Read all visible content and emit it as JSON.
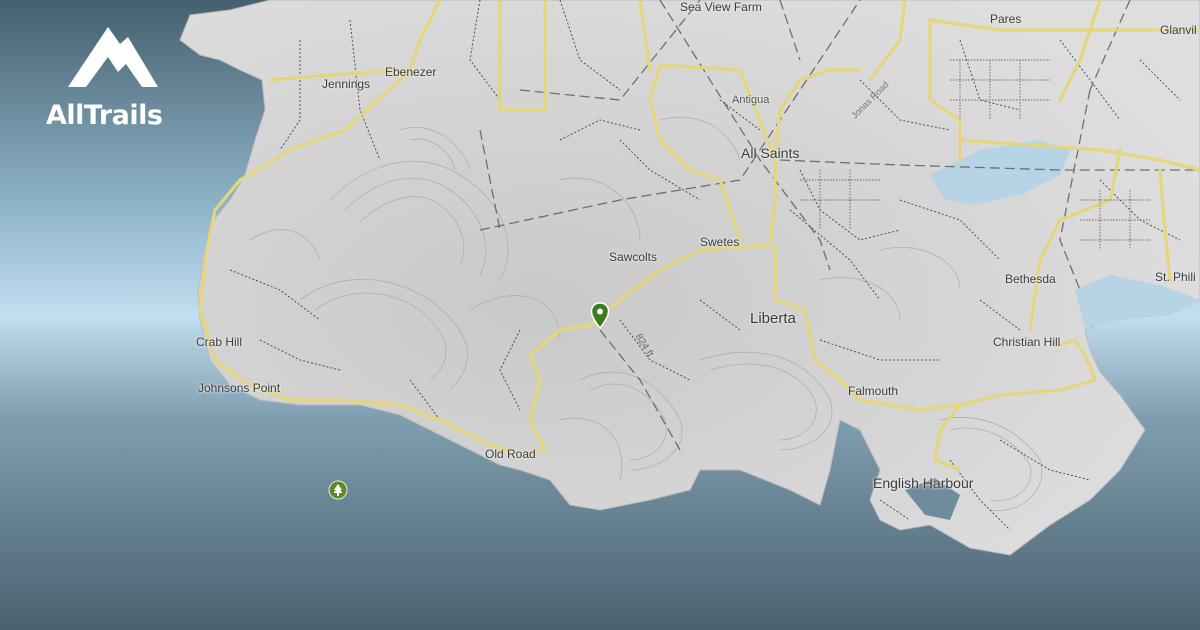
{
  "brand": {
    "name": "AllTrails",
    "logo_icon": "mountain-logo-icon"
  },
  "colors": {
    "sea": "#607785",
    "sea_light": "#bfdbea",
    "land": "#d9d9d9",
    "road": "#e8d883",
    "pin": "#3a7d1e",
    "poi": "#5e8a2c"
  },
  "places": {
    "sea_view_farm": "Sea View Farm",
    "pares": "Pares",
    "glanvil": "Glanvil",
    "ebenezer": "Ebenezer",
    "jennings": "Jennings",
    "antigua": "Antigua",
    "all_saints": "All Saints",
    "sawcolts": "Sawcolts",
    "swetes": "Swetes",
    "bethesda": "Bethesda",
    "st_phil": "St. Phili",
    "liberta": "Liberta",
    "crab_hill": "Crab Hill",
    "christian_hill": "Christian Hill",
    "johnsons_point": "Johnsons Point",
    "falmouth": "Falmouth",
    "old_road": "Old Road",
    "english_harbour": "English Harbour"
  },
  "elevation_label": "824 ft",
  "road_name": "Jonas Road",
  "markers": {
    "trail_pin": "map-pin-icon",
    "park_poi": "tree-icon"
  }
}
